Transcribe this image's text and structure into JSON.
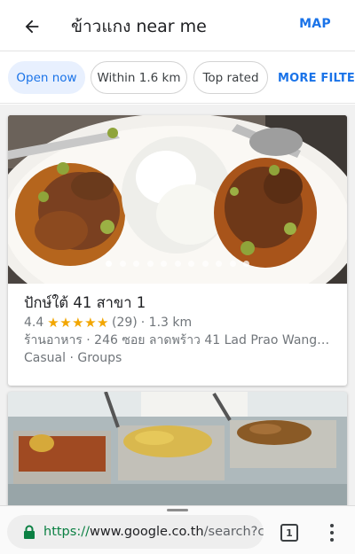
{
  "header": {
    "back_icon": "arrow-left-icon",
    "query": "ข้าวแกง near me",
    "map_label": "MAP"
  },
  "filters": {
    "chips": [
      {
        "label": "Open now",
        "active": true
      },
      {
        "label": "Within 1.6 km",
        "active": false
      },
      {
        "label": "Top rated",
        "active": false
      }
    ],
    "more_label": "MORE FILTERS"
  },
  "results": [
    {
      "name": "ปักษ์ใต้ 41 สาขา 1",
      "rating": "4.4",
      "stars": "★★★★★",
      "reviews": "(29)",
      "distance": "· 1.3 km",
      "address": "ร้านอาหาร · 246 ซอย ลาดพร้าว 41 Lad Prao Wang…",
      "tags": "Casual · Groups",
      "photo_count": 11,
      "active_photo_index": 0
    }
  ],
  "browser": {
    "url_scheme": "https://",
    "url_host": "www.google.co.th",
    "url_path": "/search?c",
    "tab_count": "1",
    "lock_icon": "lock-icon",
    "menu_icon": "more-vertical-icon"
  },
  "colors": {
    "accent": "#1a73e8",
    "star": "#f2a600",
    "secure_green": "#0b8043"
  }
}
